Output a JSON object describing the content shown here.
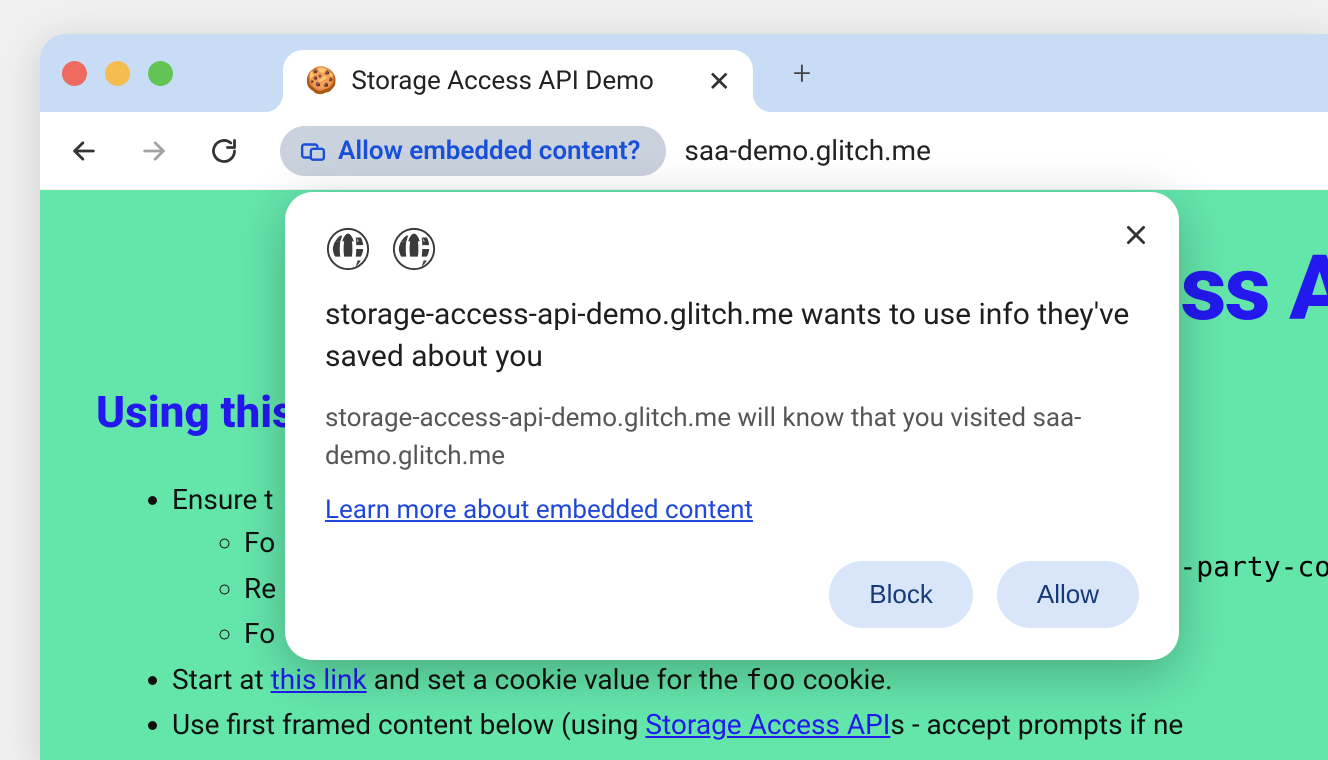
{
  "tab": {
    "favicon": "🍪",
    "title": "Storage Access API Demo"
  },
  "omnibox": {
    "chip_label": "Allow embedded content?",
    "url": "saa-demo.glitch.me"
  },
  "popover": {
    "title": "storage-access-api-demo.glitch.me wants to use info they've saved about you",
    "description": "storage-access-api-demo.glitch.me will know that you visited saa-demo.glitch.me",
    "learn_more": "Learn more about embedded content",
    "block": "Block",
    "allow": "Allow"
  },
  "page": {
    "big_title_frag": "ss A",
    "heading": "Using this",
    "li1_a": "Ensure t",
    "li1_sub1": "Fo",
    "li1_sub2": "Re",
    "li1_sub3": "Fo",
    "li2_pre": "Start at ",
    "li2_link": "this link",
    "li2_mid": " and set a cookie value for the ",
    "li2_code": "foo",
    "li2_post": " cookie.",
    "li3_pre": "Use first framed content below (using ",
    "li3_link": "Storage Access API",
    "li3_post": "s - accept prompts if ne",
    "mono_frag": "-party-coo"
  }
}
